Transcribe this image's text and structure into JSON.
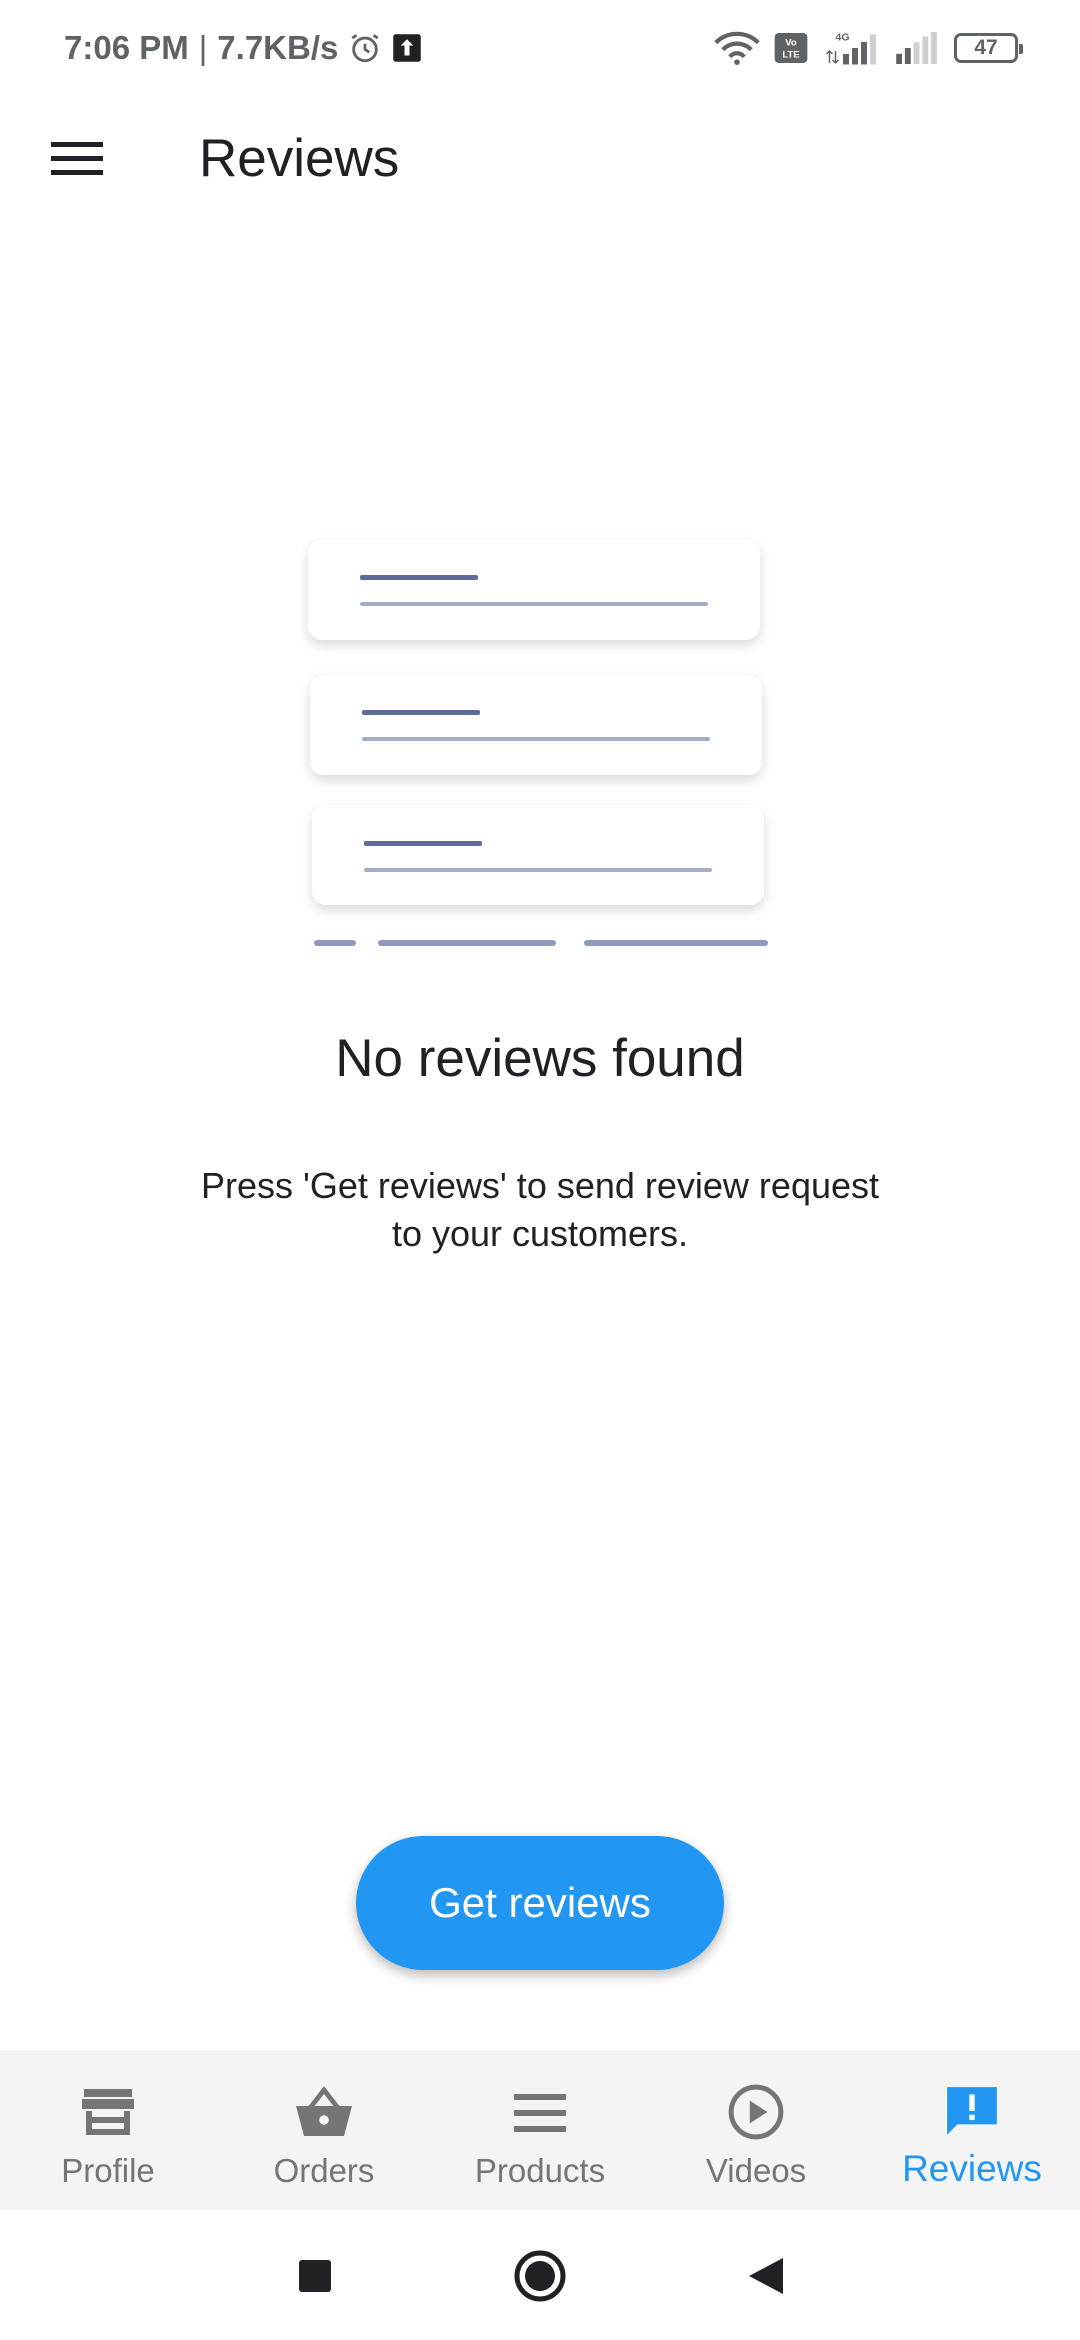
{
  "status_bar": {
    "time": "7:06 PM",
    "separator": "|",
    "net_speed": "7.7KB/s",
    "battery": "47",
    "icons": [
      "alarm-icon",
      "upload-notification-icon",
      "wifi-icon",
      "volte-icon",
      "signal-4g-icon",
      "signal-icon",
      "battery-icon"
    ]
  },
  "app_bar": {
    "menu_icon": "hamburger-menu-icon",
    "title": "Reviews"
  },
  "empty_state": {
    "illustration": "review-cards-illustration",
    "title": "No reviews found",
    "message": "Press 'Get reviews' to send review request to your customers."
  },
  "cta": {
    "label": "Get reviews"
  },
  "bottom_nav": {
    "items": [
      {
        "label": "Profile",
        "icon": "storefront-icon",
        "active": false
      },
      {
        "label": "Orders",
        "icon": "basket-icon",
        "active": false
      },
      {
        "label": "Products",
        "icon": "list-icon",
        "active": false
      },
      {
        "label": "Videos",
        "icon": "play-circle-icon",
        "active": false
      },
      {
        "label": "Reviews",
        "icon": "feedback-icon",
        "active": true
      }
    ]
  },
  "colors": {
    "accent": "#2196f3",
    "text_primary": "#202124",
    "nav_inactive": "#757575",
    "illustration_dark_line": "#5c6b9a",
    "illustration_light_line": "#a3aec4"
  }
}
